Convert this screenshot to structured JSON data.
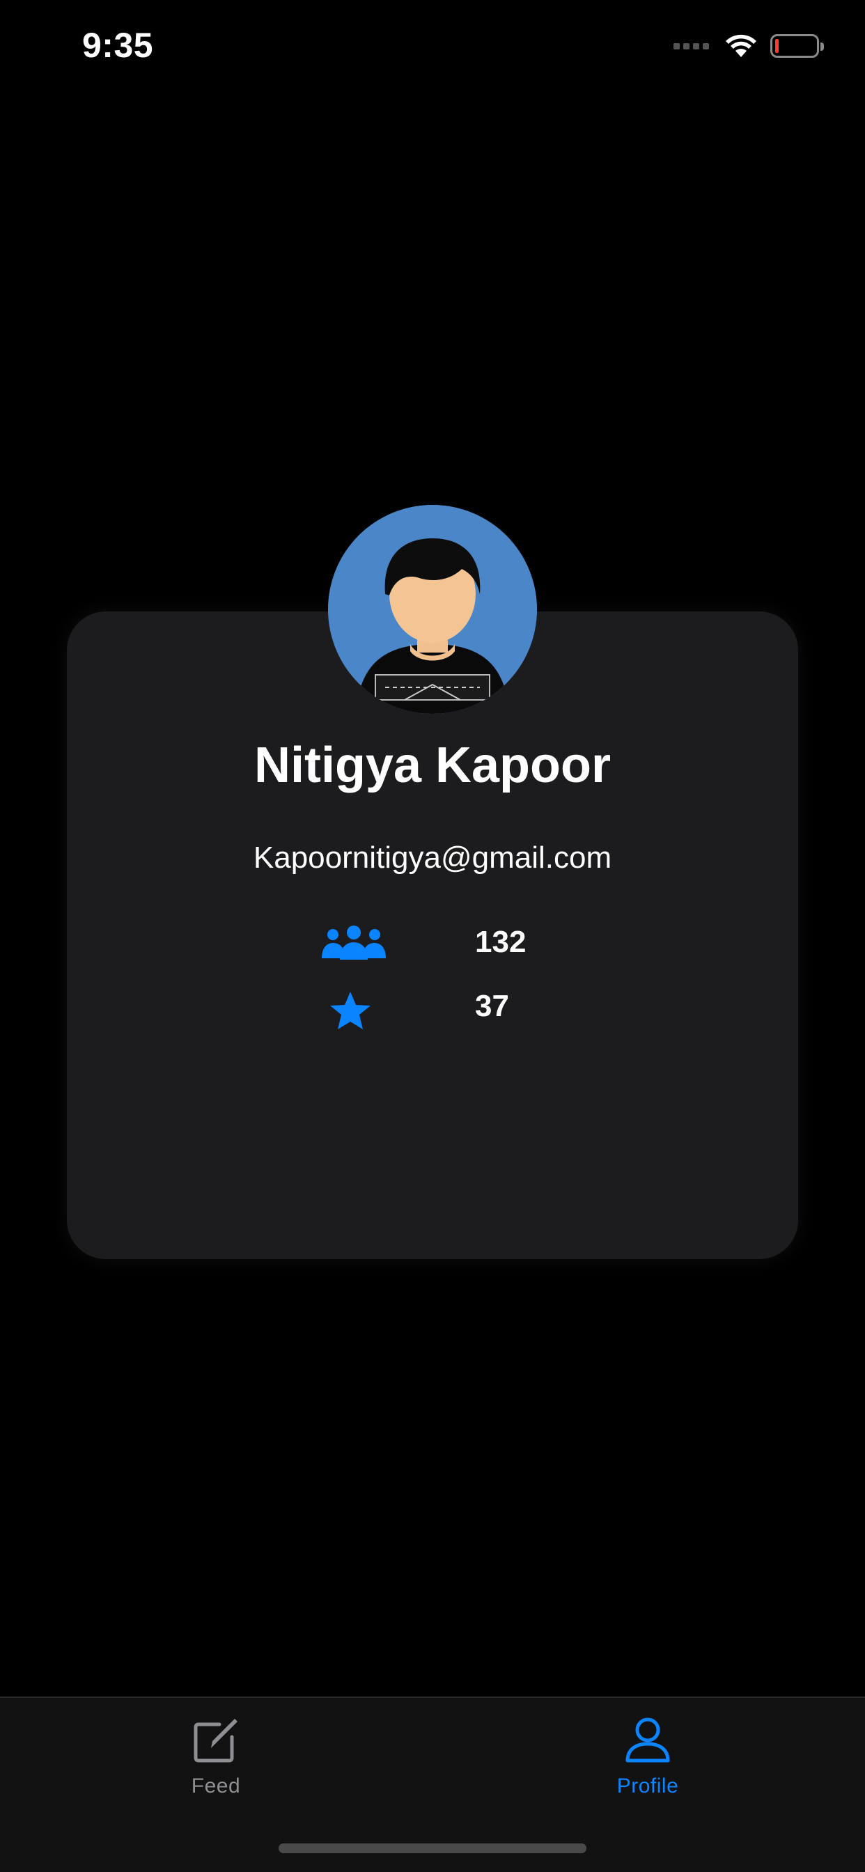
{
  "status_bar": {
    "time": "9:35",
    "icons": [
      "cellular-signal-icon",
      "wifi-icon",
      "battery-icon"
    ]
  },
  "profile": {
    "name": "Nitigya Kapoor",
    "email": "Kapoornitigya@gmail.com",
    "stats": [
      {
        "icon": "people-icon",
        "value": "132"
      },
      {
        "icon": "star-icon",
        "value": "37"
      }
    ]
  },
  "tab_bar": {
    "items": [
      {
        "label": "Feed",
        "icon": "compose-icon",
        "selected": false
      },
      {
        "label": "Profile",
        "icon": "person-icon",
        "selected": true
      }
    ]
  },
  "colors": {
    "accent": "#0a84ff",
    "card": "#1c1c1e",
    "background": "#000000",
    "avatar_bg": "#4a86c8",
    "battery_low": "#ff3b30",
    "tab_inactive": "#8e8e93"
  }
}
